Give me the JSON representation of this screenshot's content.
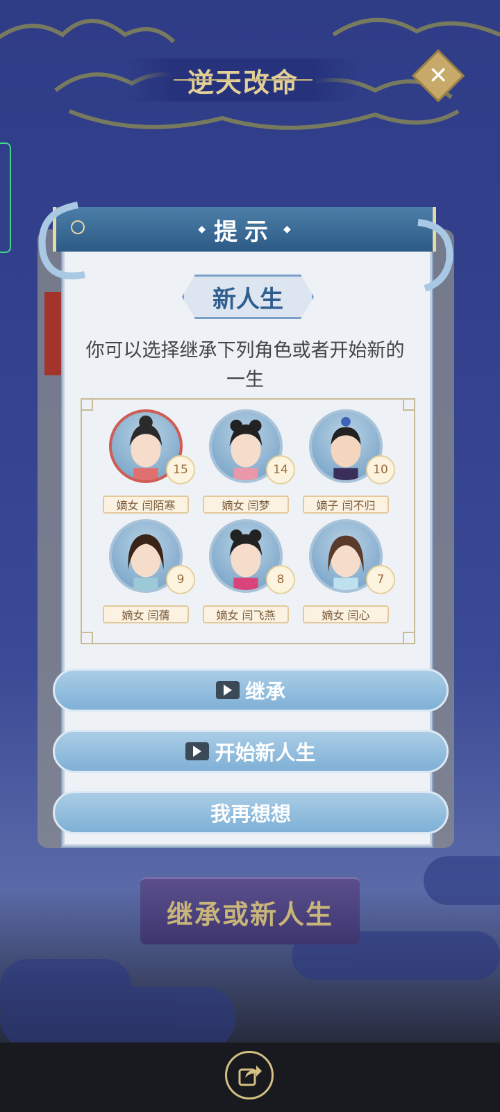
{
  "top": {
    "title": "逆天改命"
  },
  "dialog": {
    "header": "提示",
    "subtitle": "新人生",
    "description": "你可以选择继承下列角色或者开始新的一生"
  },
  "characters": [
    {
      "name": "嫡女 闫陌寒",
      "level": "15",
      "selected": true
    },
    {
      "name": "嫡女 闫梦",
      "level": "14",
      "selected": false
    },
    {
      "name": "嫡子 闫不归",
      "level": "10",
      "selected": false
    },
    {
      "name": "嫡女 闫蒨",
      "level": "9",
      "selected": false
    },
    {
      "name": "嫡女 闫飞燕",
      "level": "8",
      "selected": false
    },
    {
      "name": "嫡女 闫心",
      "level": "7",
      "selected": false
    }
  ],
  "buttons": {
    "inherit": "继承",
    "new_life": "开始新人生",
    "think": "我再想想"
  },
  "bottom": {
    "action": "继承或新人生"
  },
  "icons": {
    "close": "close-icon",
    "play": "video-play-icon",
    "share": "share-icon"
  },
  "colors": {
    "accent": "#4b7fa8",
    "gold": "#e3cf98",
    "button": "#8fbde0"
  }
}
